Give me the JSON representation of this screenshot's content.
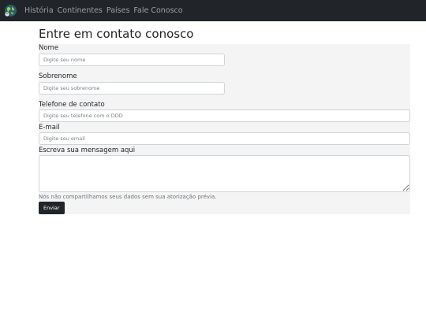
{
  "navbar": {
    "logo_icon": "globe-icon",
    "links": [
      {
        "label": "História"
      },
      {
        "label": "Continentes"
      },
      {
        "label": "Países"
      },
      {
        "label": "Fale Conosco"
      }
    ]
  },
  "page": {
    "title": "Entre em contato conosco"
  },
  "form": {
    "nome": {
      "label": "Nome",
      "placeholder": "Digite seu nome",
      "value": ""
    },
    "sobrenome": {
      "label": "Sobrenome",
      "placeholder": "Digite seu sobrenome",
      "value": ""
    },
    "telefone": {
      "label": "Telefone de contato",
      "placeholder": "Digite seu telefone com o DDD",
      "value": ""
    },
    "email": {
      "label": "E-mail",
      "placeholder": "Digite seu email",
      "value": ""
    },
    "mensagem": {
      "label": "Escreva sua mensagem aqui",
      "value": ""
    },
    "help_text": "Nós não compartilhamos seus dados sem sua atorização prévia.",
    "submit_label": "Enviar"
  },
  "colors": {
    "navbar_bg": "#212529",
    "form_bg": "#f4f4f4",
    "button_bg": "#212529"
  }
}
